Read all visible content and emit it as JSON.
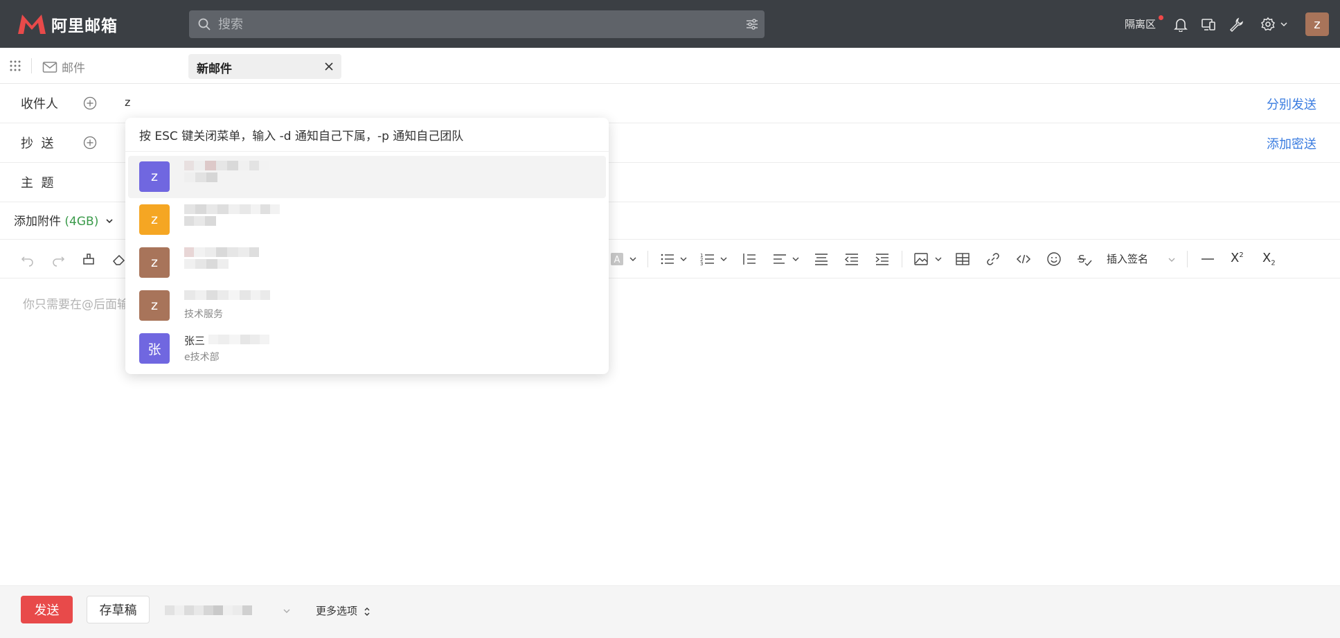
{
  "header": {
    "logo_text": "阿里邮箱",
    "search_placeholder": "搜索",
    "quarantine_label": "隔离区",
    "user_initial": "z",
    "colors": {
      "bar": "#3b3f44",
      "logo": "#e84a4a",
      "notify_dot": "#f04848"
    }
  },
  "tabs": {
    "mail_label": "邮件",
    "new_mail_label": "新邮件"
  },
  "compose": {
    "to_label": "收件人",
    "to_value": "z",
    "send_separately": "分别发送",
    "cc_label": "抄  送",
    "add_bcc": "添加密送",
    "subject_label": "主  题",
    "attach_label": "添加附件",
    "attach_size": "(4GB)",
    "signature_label": "插入签名",
    "editor_placeholder": "你只需要在@后面输入"
  },
  "dropdown": {
    "hint": "按 ESC 键关闭菜单，输入 -d 通知自己下属，-p 通知自己团队",
    "items": [
      {
        "initial": "z",
        "color": "#7067e0",
        "name": "",
        "dept": ""
      },
      {
        "initial": "z",
        "color": "#f5a623",
        "name": "",
        "dept": ""
      },
      {
        "initial": "z",
        "color": "#a8745a",
        "name": "",
        "dept": ""
      },
      {
        "initial": "z",
        "color": "#a8745a",
        "name": "",
        "dept": "技术服务"
      },
      {
        "initial": "张",
        "color": "#7067e0",
        "name": "张三",
        "dept": "e技术部"
      }
    ]
  },
  "footer": {
    "send_label": "发送",
    "draft_label": "存草稿",
    "more_options": "更多选项"
  },
  "accent": {
    "link": "#3a7ce0",
    "attach_size": "#3a9a4a"
  }
}
